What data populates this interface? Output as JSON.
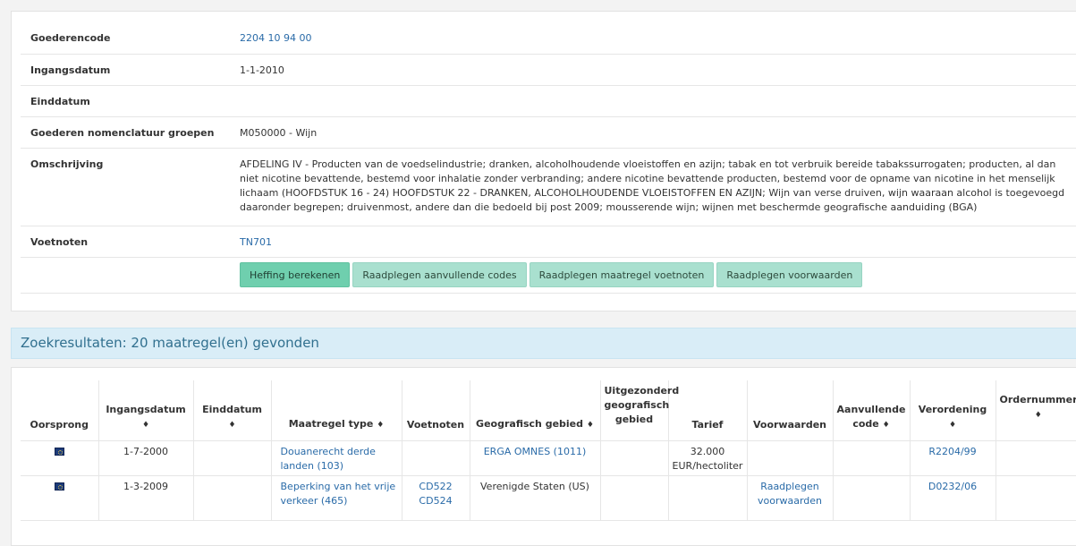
{
  "details": {
    "rows": [
      {
        "label": "Goederencode",
        "value": "2204 10 94 00"
      },
      {
        "label": "Ingangsdatum",
        "value": "1-1-2010"
      },
      {
        "label": "Einddatum",
        "value": ""
      },
      {
        "label": "Goederen nomenclatuur groepen",
        "value": "M050000 - Wijn"
      },
      {
        "label": "Omschrijving",
        "value": "AFDELING IV - Producten van de voedselindustrie; dranken, alcoholhoudende vloeistoffen en azijn; tabak en tot verbruik bereide tabakssurrogaten; producten, al dan niet nicotine bevattende, bestemd voor inhalatie zonder verbranding; andere nicotine bevattende producten, bestemd voor de opname van nicotine in het menselijk lichaam (HOOFDSTUK 16 - 24) HOOFDSTUK 22 - DRANKEN, ALCOHOLHOUDENDE VLOEISTOFFEN EN AZIJN; Wijn van verse druiven, wijn waaraan alcohol is toegevoegd daaronder begrepen; druivenmost, andere dan die bedoeld bij post 2009; mousserende wijn; wijnen met beschermde geografische aanduiding (BGA)"
      },
      {
        "label": "Voetnoten",
        "value": "TN701"
      }
    ],
    "buttons": {
      "calc": "Heffing berekenen",
      "codes": "Raadplegen aanvullende codes",
      "footnotes": "Raadplegen maatregel voetnoten",
      "conditions": "Raadplegen voorwaarden"
    }
  },
  "results": {
    "header": "Zoekresultaten: 20 maatregel(en) gevonden",
    "columns": {
      "origin": "Oorsprong",
      "start": "Ingangsdatum",
      "end": "Einddatum",
      "type": "Maatregel type",
      "notes": "Voetnoten",
      "geo": "Geografisch gebied",
      "excl": "Uitgezonderd geografisch gebied",
      "tariff": "Tarief",
      "cond": "Voorwaarden",
      "addcode": "Aanvullende code",
      "reg": "Verordening",
      "order": "Ordernummer",
      "sort_icon": "♦"
    },
    "rows": [
      {
        "start": "1-7-2000",
        "end": "",
        "type": "Douanerecht derde landen (103)",
        "note1": "",
        "note2": "",
        "geo": "ERGA OMNES (1011)",
        "excl": "",
        "tariff": "32.000 EUR/hectoliter",
        "cond": "",
        "addcode": "",
        "reg": "R2204/99",
        "order": ""
      },
      {
        "start": "1-3-2009",
        "end": "",
        "type": "Beperking van het vrije verkeer (465)",
        "note1": "CD522",
        "note2": "CD524",
        "geo": "Verenigde Staten (US)",
        "excl": "",
        "tariff": "",
        "cond": "Raadplegen voorwaarden",
        "addcode": "",
        "reg": "D0232/06",
        "order": ""
      }
    ]
  }
}
